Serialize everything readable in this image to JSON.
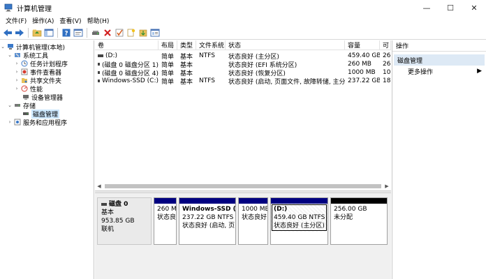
{
  "window": {
    "title": "计算机管理",
    "minimize": "—",
    "maximize": "☐",
    "close": "✕"
  },
  "menu": [
    "文件(F)",
    "操作(A)",
    "查看(V)",
    "帮助(H)"
  ],
  "tree": {
    "root": "计算机管理(本地)",
    "system_tools": "系统工具",
    "task_scheduler": "任务计划程序",
    "event_viewer": "事件查看器",
    "shared_folders": "共享文件夹",
    "performance": "性能",
    "device_manager": "设备管理器",
    "storage": "存储",
    "disk_management": "磁盘管理",
    "services": "服务和应用程序"
  },
  "volume_table": {
    "headers": [
      "卷",
      "布局",
      "类型",
      "文件系统",
      "状态",
      "容量",
      "可"
    ],
    "rows": [
      [
        "(D:)",
        "简单",
        "基本",
        "NTFS",
        "状态良好 (主分区)",
        "459.40 GB",
        "26"
      ],
      [
        "(磁盘 0 磁盘分区 1)",
        "简单",
        "基本",
        "",
        "状态良好 (EFI 系统分区)",
        "260 MB",
        "26"
      ],
      [
        "(磁盘 0 磁盘分区 4)",
        "简单",
        "基本",
        "",
        "状态良好 (恢复分区)",
        "1000 MB",
        "10"
      ],
      [
        "Windows-SSD (C:)",
        "简单",
        "基本",
        "NTFS",
        "状态良好 (启动, 页面文件, 故障转储, 主分区)",
        "237.22 GB",
        "18"
      ]
    ]
  },
  "disk": {
    "name": "磁盘 0",
    "type": "基本",
    "size": "953.85 GB",
    "status": "联机"
  },
  "partitions": [
    {
      "name": "",
      "line1": "260 M",
      "line2": "状态良"
    },
    {
      "name": "Windows-SSD (C",
      "line1": "237.22 GB NTFS",
      "line2": "状态良好 (启动, 页"
    },
    {
      "name": "",
      "line1": "1000 MB",
      "line2": "状态良好"
    },
    {
      "name": "(D:)",
      "line1": "459.40 GB NTFS",
      "line2": "状态良好 (主分区)"
    },
    {
      "name": "",
      "line1": "256.00 GB",
      "line2": "未分配"
    }
  ],
  "actions": {
    "title": "操作",
    "section": "磁盘管理",
    "more": "更多操作",
    "more_arrow": "▶"
  },
  "colors": {
    "partition_bar": "#000080",
    "unallocated_bar": "#000000",
    "selection": "#cde8ff"
  }
}
